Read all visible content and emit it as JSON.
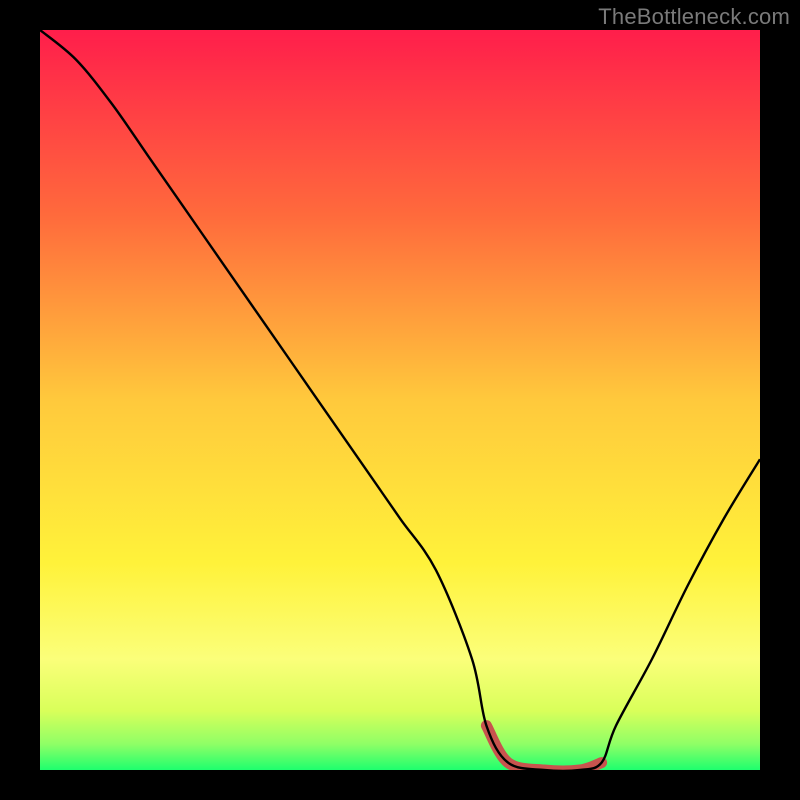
{
  "watermark": "TheBottleneck.com",
  "chart_data": {
    "type": "line",
    "title": "",
    "xlabel": "",
    "ylabel": "",
    "xlim": [
      0,
      100
    ],
    "ylim": [
      0,
      100
    ],
    "x": [
      0,
      5,
      10,
      15,
      20,
      25,
      30,
      35,
      40,
      45,
      50,
      55,
      60,
      62,
      65,
      70,
      75,
      78,
      80,
      85,
      90,
      95,
      100
    ],
    "values": [
      100,
      96,
      90,
      83,
      76,
      69,
      62,
      55,
      48,
      41,
      34,
      27,
      15,
      6,
      1,
      0,
      0,
      1,
      6,
      15,
      25,
      34,
      42
    ],
    "highlight_x_range": [
      62,
      78
    ],
    "gradient_stops": [
      {
        "offset": 0.0,
        "color": "#ff1e4b"
      },
      {
        "offset": 0.25,
        "color": "#ff6a3c"
      },
      {
        "offset": 0.5,
        "color": "#ffc93c"
      },
      {
        "offset": 0.72,
        "color": "#fff23a"
      },
      {
        "offset": 0.85,
        "color": "#fbff7a"
      },
      {
        "offset": 0.92,
        "color": "#d9ff5a"
      },
      {
        "offset": 0.965,
        "color": "#8fff66"
      },
      {
        "offset": 1.0,
        "color": "#1eff6e"
      }
    ],
    "highlight_color": "#c8544e"
  }
}
